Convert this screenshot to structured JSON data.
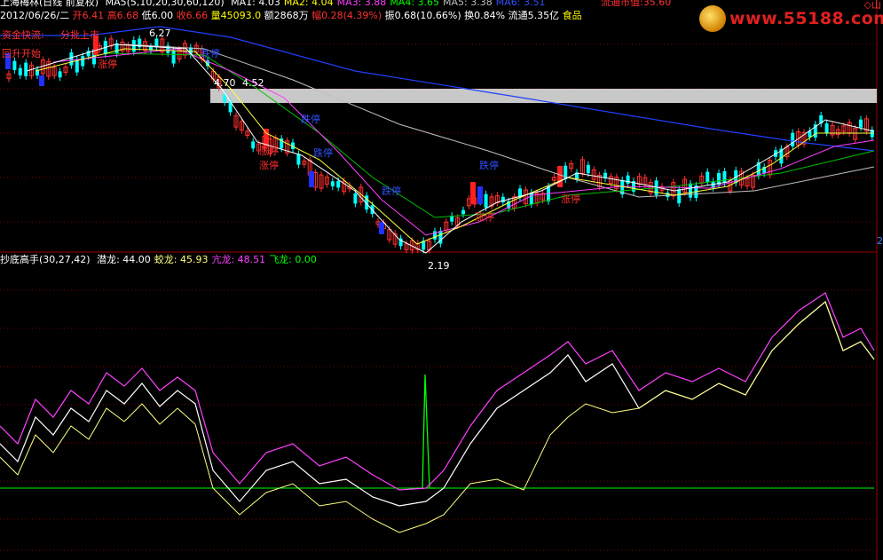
{
  "header": {
    "stock_name": "上海梅林(日线 前复权)",
    "ma_params": "MA5(5,10,20,30,60,120)",
    "ma_values": [
      {
        "label": "MA1:",
        "value": "4.03",
        "color": "#ffffff"
      },
      {
        "label": "MA2:",
        "value": "4.04",
        "color": "#ffff00"
      },
      {
        "label": "MA3:",
        "value": "3.88",
        "color": "#ff40ff"
      },
      {
        "label": "MA4:",
        "value": "3.65",
        "color": "#00ff00"
      },
      {
        "label": "MA5:",
        "value": "3.38",
        "color": "#c0c0c0"
      },
      {
        "label": "MA6:",
        "value": "3.51",
        "color": "#3050ff"
      }
    ],
    "market_cap_label": "流通市值:",
    "market_cap_value": "35.60"
  },
  "quote": {
    "date": "2012/06/26/二",
    "open_label": "开",
    "open": "6.41",
    "high_label": "高",
    "high": "6.68",
    "low_label": "低",
    "low": "6.00",
    "close_label": "收",
    "close": "6.66",
    "volume_label": "量",
    "volume": "45093.0",
    "amount_label": "额",
    "amount": "2868万",
    "change_label": "幅",
    "change": "0.28(4.39%)",
    "amplitude_label": "振",
    "amplitude": "0.68(10.66%)",
    "turnover_label": "换",
    "turnover": "0.84%",
    "float_label": "流通",
    "float": "5.35亿",
    "sector": "食品"
  },
  "annotations": {
    "high_price": "6.27",
    "mid_price_a": "4.70",
    "mid_price_b": "4.52",
    "low_price": "2.19",
    "left_label_1": "资金快流:",
    "left_label_2": "分批上市",
    "left_label_3": "回升开始",
    "left_label_4": "涨停",
    "limit_up": "涨停",
    "limit_down": "跌停"
  },
  "indicator": {
    "name": "抄底高手(30,27,42)",
    "lines": [
      {
        "label": "潜龙:",
        "value": "44.00",
        "color": "#ffffff"
      },
      {
        "label": "蛟龙:",
        "value": "45.93",
        "color": "#ffff80"
      },
      {
        "label": "亢龙:",
        "value": "48.51",
        "color": "#ff40ff"
      },
      {
        "label": "飞龙:",
        "value": "0.00",
        "color": "#00ff00"
      }
    ]
  },
  "logo": {
    "text": "www.55188.com"
  },
  "right_edge": {
    "top_text": "◇山",
    "mid_text": "2"
  },
  "colors": {
    "up": "#ff3030",
    "down": "#00ffff",
    "blue": "#3030ff",
    "highlight": "#c0c0c0"
  }
}
